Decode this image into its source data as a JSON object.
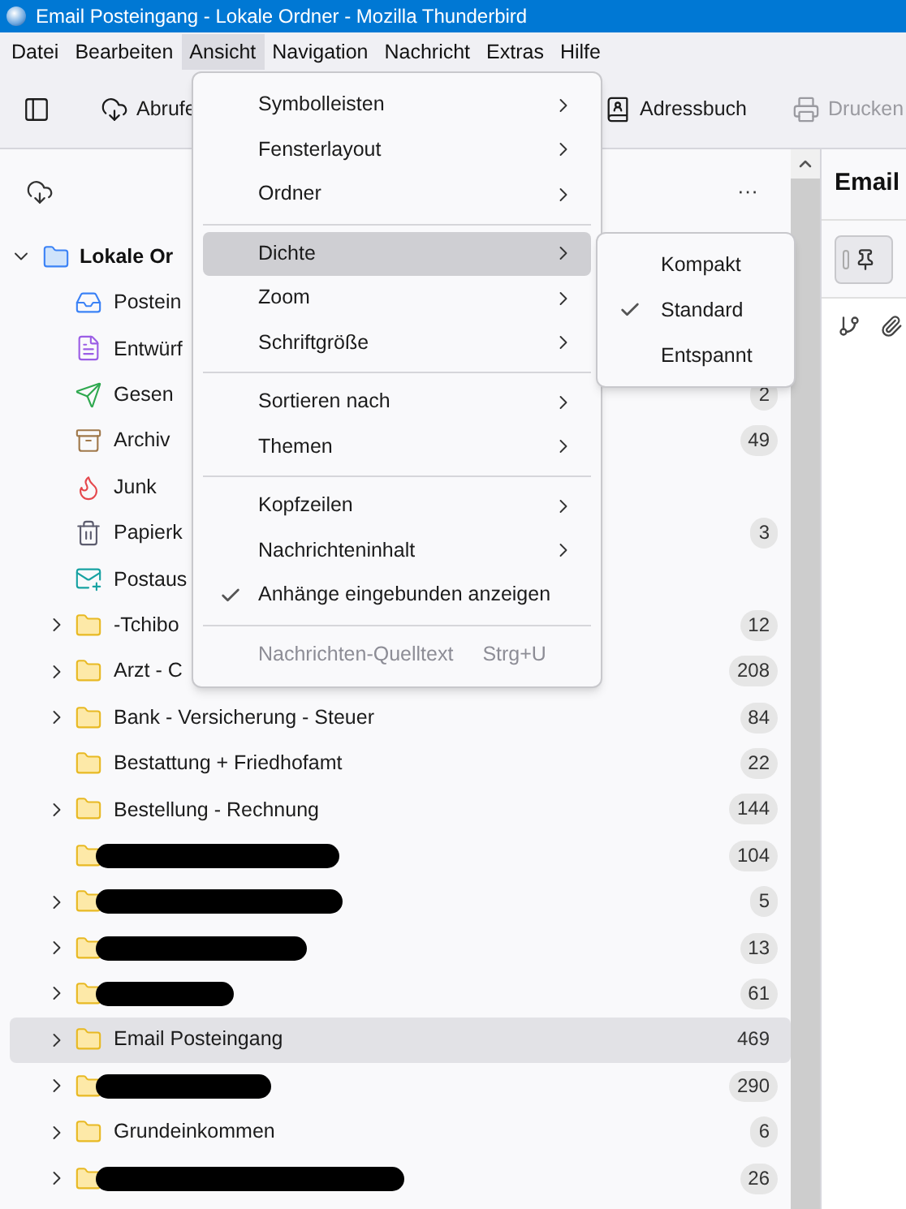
{
  "window": {
    "title": "Email Posteingang - Lokale Ordner - Mozilla Thunderbird"
  },
  "menubar": [
    {
      "label": "Datei",
      "selected": false
    },
    {
      "label": "Bearbeiten",
      "selected": false
    },
    {
      "label": "Ansicht",
      "selected": true
    },
    {
      "label": "Navigation",
      "selected": false
    },
    {
      "label": "Nachricht",
      "selected": false
    },
    {
      "label": "Extras",
      "selected": false
    },
    {
      "label": "Hilfe",
      "selected": false
    }
  ],
  "toolbar": [
    {
      "kind": "sidebar",
      "disabled": false
    },
    {
      "kind": "fetch",
      "label": "Abrufe",
      "disabled": false
    },
    {
      "kind": "addressbook",
      "label": "Adressbuch",
      "disabled": false
    },
    {
      "kind": "print",
      "label": "Drucken",
      "disabled": true
    }
  ],
  "folder_pane": {
    "more": "···",
    "root": {
      "name": "Lokale Or",
      "expanded": true
    },
    "folders": [
      {
        "kind": "inbox",
        "name": "Postein",
        "expandable": false,
        "selected": false,
        "redacted": false
      },
      {
        "kind": "drafts",
        "name": "Entwürf",
        "expandable": false,
        "selected": false,
        "redacted": false
      },
      {
        "kind": "sent",
        "name": "Gesen",
        "expandable": false,
        "count": "2",
        "selected": false,
        "redacted": false
      },
      {
        "kind": "archive",
        "name": "Archiv",
        "expandable": false,
        "count": "49",
        "selected": false,
        "redacted": false
      },
      {
        "kind": "junk",
        "name": "Junk",
        "expandable": false,
        "selected": false,
        "redacted": false
      },
      {
        "kind": "trash",
        "name": "Papierk",
        "expandable": false,
        "count": "3",
        "selected": false,
        "redacted": false
      },
      {
        "kind": "outbox",
        "name": "Postaus",
        "expandable": false,
        "selected": false,
        "redacted": false
      },
      {
        "kind": "folder",
        "name": "-Tchibo",
        "expandable": true,
        "count": "12",
        "selected": false,
        "redacted": false
      },
      {
        "kind": "folder",
        "name": "Arzt - C",
        "expandable": true,
        "count": "208",
        "selected": false,
        "redacted": false
      },
      {
        "kind": "folder",
        "name": "Bank - Versicherung - Steuer",
        "expandable": true,
        "count": "84",
        "selected": false,
        "redacted": false
      },
      {
        "kind": "folder",
        "name": "Bestattung + Friedhofamt",
        "expandable": false,
        "count": "22",
        "selected": false,
        "redacted": false
      },
      {
        "kind": "folder",
        "name": "Bestellung - Rechnung",
        "expandable": true,
        "count": "144",
        "selected": false,
        "redacted": false
      },
      {
        "kind": "folder",
        "expandable": false,
        "count": "104",
        "selected": false,
        "redacted": true
      },
      {
        "kind": "folder",
        "expandable": true,
        "count": "5",
        "selected": false,
        "redacted": true
      },
      {
        "kind": "folder",
        "expandable": true,
        "count": "13",
        "selected": false,
        "redacted": true
      },
      {
        "kind": "folder",
        "expandable": true,
        "count": "61",
        "selected": false,
        "redacted": true
      },
      {
        "kind": "folder",
        "name": "Email Posteingang",
        "expandable": true,
        "count": "469",
        "selected": true,
        "redacted": false
      },
      {
        "kind": "folder",
        "expandable": true,
        "count": "290",
        "selected": false,
        "redacted": true
      },
      {
        "kind": "folder",
        "name": "Grundeinkommen",
        "expandable": true,
        "count": "6",
        "selected": false,
        "redacted": false
      },
      {
        "kind": "folder",
        "expandable": true,
        "count": "26",
        "selected": false,
        "redacted": true
      }
    ]
  },
  "message_pane": {
    "title": "Email"
  },
  "view_menu": {
    "groups": [
      [
        {
          "label": "Symbolleisten",
          "submenu": true,
          "checked": false,
          "selected": false,
          "disabled": false
        },
        {
          "label": "Fensterlayout",
          "submenu": true,
          "checked": false,
          "selected": false,
          "disabled": false
        },
        {
          "label": "Ordner",
          "submenu": true,
          "checked": false,
          "selected": false,
          "disabled": false
        }
      ],
      [
        {
          "label": "Dichte",
          "submenu": true,
          "checked": false,
          "selected": true,
          "disabled": false
        },
        {
          "label": "Zoom",
          "submenu": true,
          "checked": false,
          "selected": false,
          "disabled": false
        },
        {
          "label": "Schriftgröße",
          "submenu": true,
          "checked": false,
          "selected": false,
          "disabled": false
        }
      ],
      [
        {
          "label": "Sortieren nach",
          "submenu": true,
          "checked": false,
          "selected": false,
          "disabled": false
        },
        {
          "label": "Themen",
          "submenu": true,
          "checked": false,
          "selected": false,
          "disabled": false
        }
      ],
      [
        {
          "label": "Kopfzeilen",
          "submenu": true,
          "checked": false,
          "selected": false,
          "disabled": false
        },
        {
          "label": "Nachrichteninhalt",
          "submenu": true,
          "checked": false,
          "selected": false,
          "disabled": false
        },
        {
          "label": "Anhänge eingebunden anzeigen",
          "submenu": false,
          "checked": true,
          "selected": false,
          "disabled": false
        }
      ],
      [
        {
          "label": "Nachrichten-Quelltext",
          "shortcut": "Strg+U",
          "submenu": false,
          "checked": false,
          "selected": false,
          "disabled": true
        }
      ]
    ]
  },
  "density_menu": [
    {
      "label": "Kompakt",
      "checked": false
    },
    {
      "label": "Standard",
      "checked": true
    },
    {
      "label": "Entspannt",
      "checked": false
    }
  ]
}
